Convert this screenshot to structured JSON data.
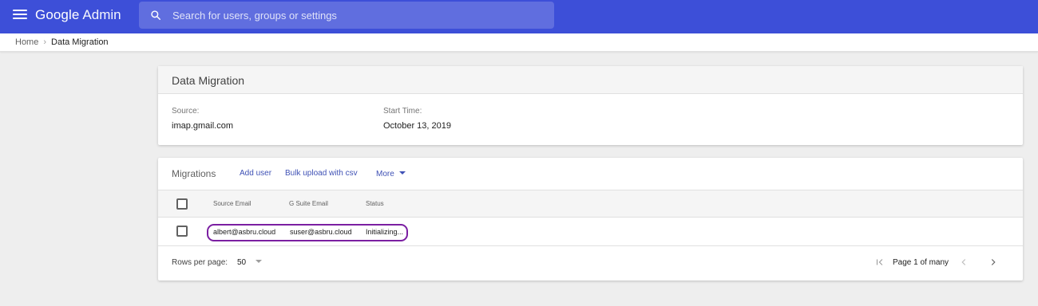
{
  "header": {
    "brand_google": "Google",
    "brand_admin": "Admin",
    "search_placeholder": "Search for users, groups or settings"
  },
  "breadcrumb": {
    "home": "Home",
    "separator": "›",
    "current": "Data Migration"
  },
  "summary_card": {
    "title": "Data Migration",
    "source_label": "Source:",
    "source_value": "imap.gmail.com",
    "start_time_label": "Start Time:",
    "start_time_value": "October 13, 2019"
  },
  "migrations_card": {
    "title": "Migrations",
    "add_user": "Add user",
    "bulk_upload": "Bulk upload with csv",
    "more": "More",
    "columns": [
      "Source Email",
      "G Suite Email",
      "Status"
    ],
    "rows": [
      {
        "source_email": "albert@asbru.cloud",
        "gsuite_email": "suser@asbru.cloud",
        "status": "Initializing..."
      }
    ],
    "rows_per_page_label": "Rows per page:",
    "rows_per_page_value": "50",
    "page_info": "Page 1 of many"
  },
  "colors": {
    "topbar": "#3d4fd8",
    "link": "#3f51b5",
    "highlight": "#7b1fa2"
  },
  "icons": [
    "menu-icon",
    "search-icon",
    "first-page-icon",
    "chevron-left-icon",
    "chevron-right-icon",
    "dropdown-caret-icon"
  ]
}
